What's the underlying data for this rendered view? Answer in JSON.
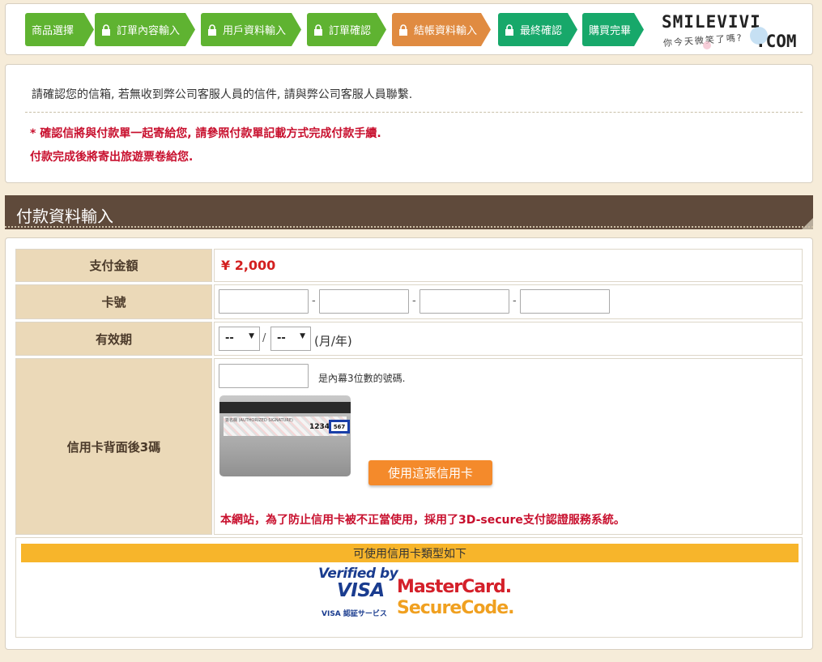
{
  "steps": [
    {
      "label": "商品選擇",
      "color": "#5fb331",
      "lock": false
    },
    {
      "label": "訂單內容輸入",
      "color": "#5fb331",
      "lock": true
    },
    {
      "label": "用戶資料輸入",
      "color": "#5fb331",
      "lock": true
    },
    {
      "label": "訂單確認",
      "color": "#5fb331",
      "lock": true
    },
    {
      "label": "結帳資料輸入",
      "color": "#e08b41",
      "lock": true
    },
    {
      "label": "最終確認",
      "color": "#17a86a",
      "lock": true
    },
    {
      "label": "購買完畢",
      "color": "#17a86a",
      "lock": false
    }
  ],
  "logo": {
    "main": "SMILEVIVI",
    "sub": "你今天微笑了嗎?",
    "com": ".COM"
  },
  "notice": {
    "line1": "請確認您的信箱, 若無收到弊公司客服人員的信件, 請與弊公司客服人員聯繫.",
    "warning1": "* 確認信將與付款單一起寄給您, 請參照付款單記載方式完成付款手續.",
    "warning2": "付款完成後將寄出旅遊票卷給您."
  },
  "section": {
    "title": "付款資料輸入"
  },
  "form": {
    "amount_label": "支付金額",
    "amount_value": "¥ 2,000",
    "card_label": "卡號",
    "card_separator": "-",
    "expiry_label": "有效期",
    "expiry_month": "--",
    "expiry_year": "--",
    "expiry_slash": "/",
    "expiry_hint": "(月/年)",
    "cvv_label": "信用卡背面後3碼",
    "cvv_hint": "是內幕3位數的號碼.",
    "card_image": {
      "sig_text": "簽名欄 (AUTHORIZED SIGNATURE)",
      "number": "1234",
      "cvv": "567"
    },
    "use_card_button": "使用這張信用卡",
    "secure_note": "本網站，為了防止信用卡被不正當使用，採用了3D-secure支付認證服務系統。"
  },
  "card_types": {
    "title": "可使用信用卡類型如下",
    "verified_by": "Verified by",
    "visa": "VISA",
    "visa_jp": "VISA 認証サービス",
    "mastercard": "MasterCard.",
    "securecode": "SecureCode."
  }
}
